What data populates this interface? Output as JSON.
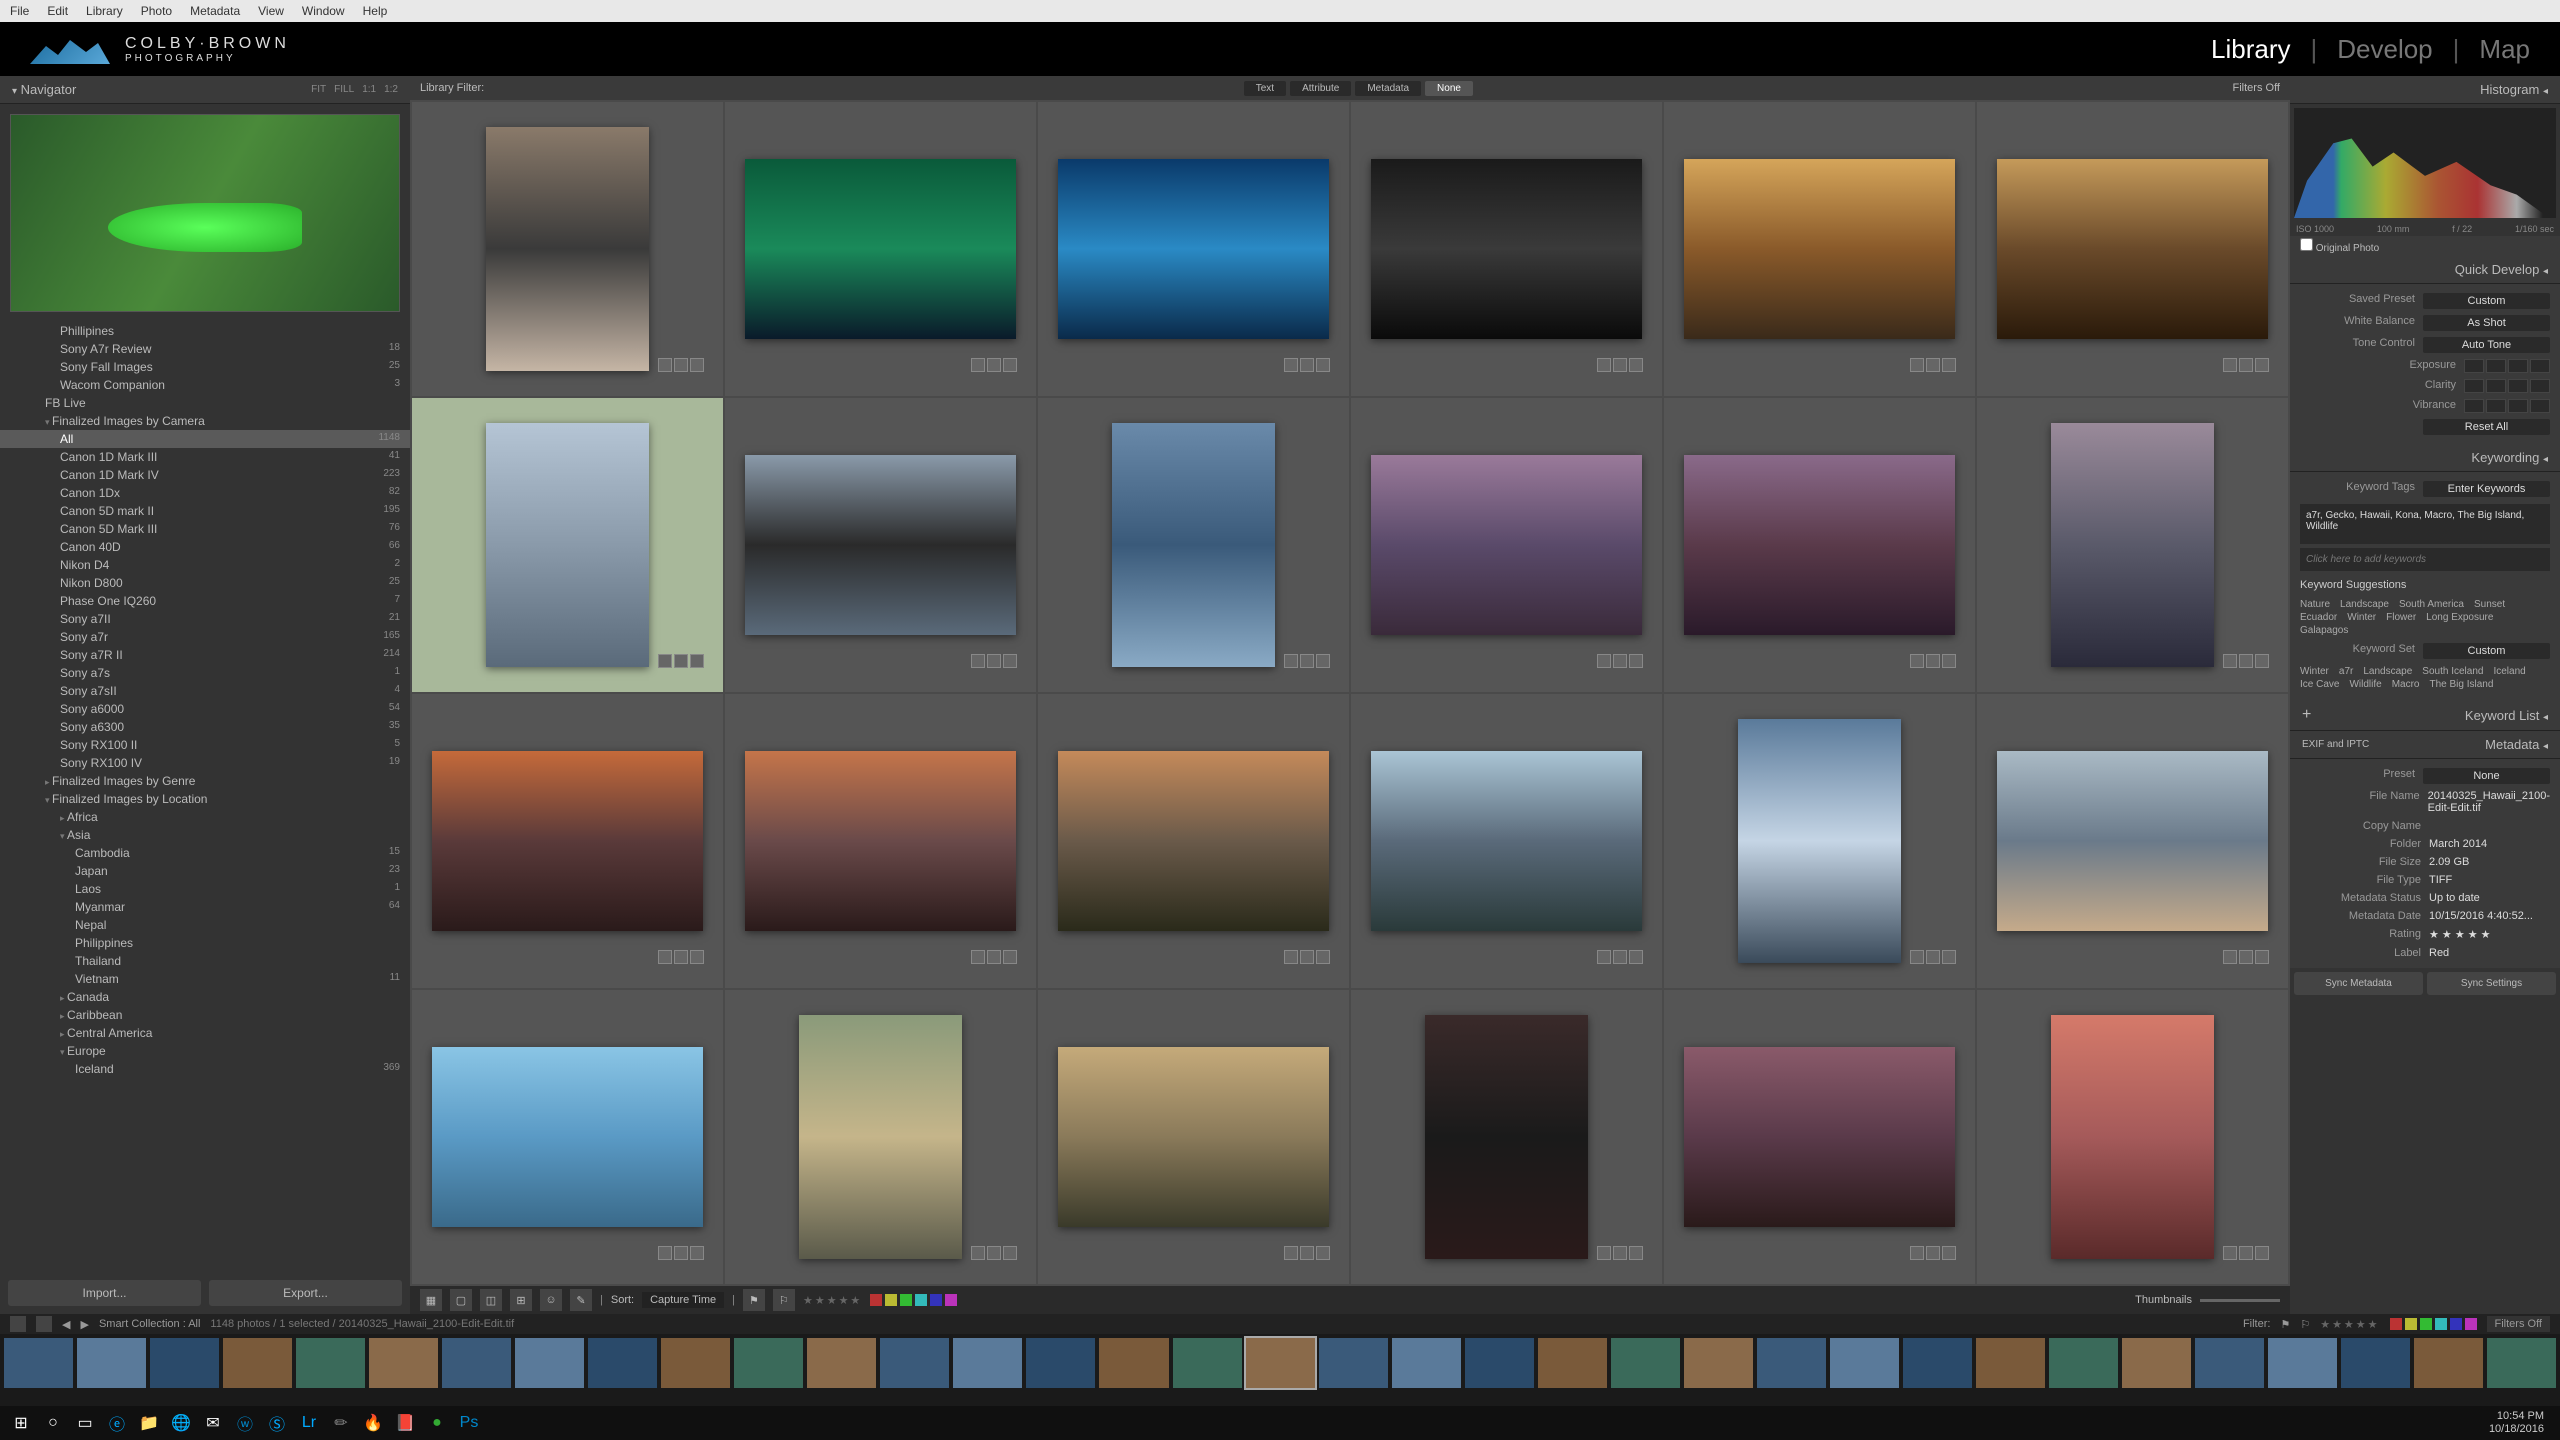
{
  "menu": [
    "File",
    "Edit",
    "Library",
    "Photo",
    "Metadata",
    "View",
    "Window",
    "Help"
  ],
  "logo": {
    "line1": "COLBY·BROWN",
    "line2": "PHOTOGRAPHY"
  },
  "modules": [
    "Library",
    "Develop",
    "Map"
  ],
  "active_module": "Library",
  "navigator": {
    "title": "Navigator",
    "modes": [
      "FIT",
      "FILL",
      "1:1",
      "1:2"
    ]
  },
  "folders": [
    {
      "name": "Phillipines",
      "count": "",
      "indent": 60,
      "cls": "leaf"
    },
    {
      "name": "Sony A7r Review",
      "count": "18",
      "indent": 60,
      "cls": "leaf"
    },
    {
      "name": "Sony Fall Images",
      "count": "25",
      "indent": 60,
      "cls": "leaf"
    },
    {
      "name": "Wacom Companion",
      "count": "3",
      "indent": 60,
      "cls": "leaf"
    },
    {
      "name": "FB Live",
      "count": "",
      "indent": 45,
      "cls": "leaf"
    },
    {
      "name": "Finalized Images by Camera",
      "count": "",
      "indent": 45,
      "cls": "expanded"
    },
    {
      "name": "All",
      "count": "1148",
      "indent": 60,
      "cls": "leaf selected"
    },
    {
      "name": "Canon 1D Mark III",
      "count": "41",
      "indent": 60,
      "cls": "leaf"
    },
    {
      "name": "Canon 1D Mark IV",
      "count": "223",
      "indent": 60,
      "cls": "leaf"
    },
    {
      "name": "Canon 1Dx",
      "count": "82",
      "indent": 60,
      "cls": "leaf"
    },
    {
      "name": "Canon 5D mark II",
      "count": "195",
      "indent": 60,
      "cls": "leaf"
    },
    {
      "name": "Canon 5D Mark III",
      "count": "76",
      "indent": 60,
      "cls": "leaf"
    },
    {
      "name": "Canon 40D",
      "count": "66",
      "indent": 60,
      "cls": "leaf"
    },
    {
      "name": "Nikon D4",
      "count": "2",
      "indent": 60,
      "cls": "leaf"
    },
    {
      "name": "Nikon D800",
      "count": "25",
      "indent": 60,
      "cls": "leaf"
    },
    {
      "name": "Phase One IQ260",
      "count": "7",
      "indent": 60,
      "cls": "leaf"
    },
    {
      "name": "Sony a7II",
      "count": "21",
      "indent": 60,
      "cls": "leaf"
    },
    {
      "name": "Sony a7r",
      "count": "165",
      "indent": 60,
      "cls": "leaf"
    },
    {
      "name": "Sony a7R II",
      "count": "214",
      "indent": 60,
      "cls": "leaf"
    },
    {
      "name": "Sony a7s",
      "count": "1",
      "indent": 60,
      "cls": "leaf"
    },
    {
      "name": "Sony a7sII",
      "count": "4",
      "indent": 60,
      "cls": "leaf"
    },
    {
      "name": "Sony a6000",
      "count": "54",
      "indent": 60,
      "cls": "leaf"
    },
    {
      "name": "Sony a6300",
      "count": "35",
      "indent": 60,
      "cls": "leaf"
    },
    {
      "name": "Sony RX100 II",
      "count": "5",
      "indent": 60,
      "cls": "leaf"
    },
    {
      "name": "Sony RX100 IV",
      "count": "19",
      "indent": 60,
      "cls": "leaf"
    },
    {
      "name": "Finalized Images by Genre",
      "count": "",
      "indent": 45,
      "cls": ""
    },
    {
      "name": "Finalized Images by Location",
      "count": "",
      "indent": 45,
      "cls": "expanded"
    },
    {
      "name": "Africa",
      "count": "",
      "indent": 60,
      "cls": ""
    },
    {
      "name": "Asia",
      "count": "",
      "indent": 60,
      "cls": "expanded"
    },
    {
      "name": "Cambodia",
      "count": "15",
      "indent": 75,
      "cls": "leaf"
    },
    {
      "name": "Japan",
      "count": "23",
      "indent": 75,
      "cls": "leaf"
    },
    {
      "name": "Laos",
      "count": "1",
      "indent": 75,
      "cls": "leaf"
    },
    {
      "name": "Myanmar",
      "count": "64",
      "indent": 75,
      "cls": "leaf"
    },
    {
      "name": "Nepal",
      "count": "",
      "indent": 75,
      "cls": "leaf"
    },
    {
      "name": "Philippines",
      "count": "",
      "indent": 75,
      "cls": "leaf"
    },
    {
      "name": "Thailand",
      "count": "",
      "indent": 75,
      "cls": "leaf"
    },
    {
      "name": "Vietnam",
      "count": "11",
      "indent": 75,
      "cls": "leaf"
    },
    {
      "name": "Canada",
      "count": "",
      "indent": 60,
      "cls": ""
    },
    {
      "name": "Caribbean",
      "count": "",
      "indent": 60,
      "cls": ""
    },
    {
      "name": "Central America",
      "count": "",
      "indent": 60,
      "cls": ""
    },
    {
      "name": "Europe",
      "count": "",
      "indent": 60,
      "cls": "expanded"
    },
    {
      "name": "Iceland",
      "count": "369",
      "indent": 75,
      "cls": "leaf"
    }
  ],
  "import_btn": "Import...",
  "export_btn": "Export...",
  "filter_bar": {
    "label": "Library Filter:",
    "types": [
      "Text",
      "Attribute",
      "Metadata",
      "None"
    ],
    "active": "None",
    "status": "Filters Off"
  },
  "grid": [
    {
      "orient": "portrait",
      "bg": "linear-gradient(#8a7a6a,#3a3a3a,#c5b5a5)",
      "sel": false
    },
    {
      "orient": "landscape",
      "bg": "linear-gradient(#0a5a3a,#1a8a5a,#0a1a2a)",
      "sel": false
    },
    {
      "orient": "landscape",
      "bg": "linear-gradient(#0a3a6a,#2a8ac5,#0a2a4a)",
      "sel": false
    },
    {
      "orient": "landscape",
      "bg": "linear-gradient(#1a1a1a,#3a3a3a,#0a0a0a)",
      "sel": false
    },
    {
      "orient": "landscape",
      "bg": "linear-gradient(#d5a55a,#8a5a2a,#3a2a1a)",
      "sel": false
    },
    {
      "orient": "landscape",
      "bg": "linear-gradient(#c59a5a,#6a4a2a,#2a1a0a)",
      "sel": false
    },
    {
      "orient": "portrait",
      "bg": "linear-gradient(#b5c5d5,#8a9aaa,#5a6a7a)",
      "sel": true
    },
    {
      "orient": "landscape",
      "bg": "linear-gradient(#8a9aaa,#2a2a2a,#5a6a7a)",
      "sel": false
    },
    {
      "orient": "portrait",
      "bg": "linear-gradient(#6a8aaa,#3a5a7a,#8aaac5)",
      "sel": false
    },
    {
      "orient": "landscape",
      "bg": "linear-gradient(#9a7a9a,#5a4a6a,#3a2a3a)",
      "sel": false
    },
    {
      "orient": "landscape",
      "bg": "linear-gradient(#8a6a8a,#5a3a4a,#2a1a2a)",
      "sel": false
    },
    {
      "orient": "portrait",
      "bg": "linear-gradient(#9a8a9a,#5a5a6a,#2a2a3a)",
      "sel": false
    },
    {
      "orient": "landscape",
      "bg": "linear-gradient(#c56a3a,#5a3a3a,#2a1a1a)",
      "sel": false
    },
    {
      "orient": "landscape",
      "bg": "linear-gradient(#c5754a,#6a4a4a,#2a1a1a)",
      "sel": false
    },
    {
      "orient": "landscape",
      "bg": "linear-gradient(#c58a5a,#6a5a4a,#2a2a1a)",
      "sel": false
    },
    {
      "orient": "landscape",
      "bg": "linear-gradient(#aac5d5,#5a6a7a,#2a3a3a)",
      "sel": false
    },
    {
      "orient": "portrait",
      "bg": "linear-gradient(#5a7a9a,#c5d5e5,#3a4a5a)",
      "sel": false
    },
    {
      "orient": "landscape",
      "bg": "linear-gradient(#aabac5,#6a7a8a,#c5aa8a)",
      "sel": false
    },
    {
      "orient": "landscape",
      "bg": "linear-gradient(#8ac5e5,#5a9ac5,#3a6a8a)",
      "sel": false
    },
    {
      "orient": "portrait",
      "bg": "linear-gradient(#8a9a7a,#c5b58a,#5a5a4a)",
      "sel": false
    },
    {
      "orient": "landscape",
      "bg": "linear-gradient(#c5aa7a,#8a7a5a,#3a3a2a)",
      "sel": false
    },
    {
      "orient": "portrait",
      "bg": "linear-gradient(#3a2a2a,#1a1a1a,#2a1a1a)",
      "sel": false
    },
    {
      "orient": "landscape",
      "bg": "linear-gradient(#8a5a6a,#5a3a4a,#2a1a1a)",
      "sel": false
    },
    {
      "orient": "portrait",
      "bg": "linear-gradient(#d57a6a,#a55a5a,#5a2a2a)",
      "sel": false
    }
  ],
  "toolbar": {
    "sort_label": "Sort:",
    "sort_value": "Capture Time",
    "thumbnails": "Thumbnails"
  },
  "color_swatches": [
    "#b33",
    "#bb3",
    "#3b3",
    "#3bb",
    "#33b",
    "#b3b"
  ],
  "histogram": {
    "title": "Histogram",
    "info": [
      "ISO 1000",
      "100 mm",
      "f / 22",
      "1/160 sec"
    ],
    "original": "Original Photo"
  },
  "quick_develop": {
    "title": "Quick Develop",
    "saved_preset": {
      "label": "Saved Preset",
      "value": "Custom"
    },
    "white_balance": {
      "label": "White Balance",
      "value": "As Shot"
    },
    "tone_control": {
      "label": "Tone Control",
      "value": "Auto Tone"
    },
    "exposure": "Exposure",
    "clarity": "Clarity",
    "vibrance": "Vibrance",
    "reset": "Reset All"
  },
  "keywording": {
    "title": "Keywording",
    "tags_label": "Keyword Tags",
    "tags_mode": "Enter Keywords",
    "keywords": "a7r, Gecko, Hawaii, Kona, Macro, The Big Island, Wildlife",
    "placeholder": "Click here to add keywords",
    "suggestions_label": "Keyword Suggestions",
    "suggestions": [
      "Nature",
      "Landscape",
      "South America",
      "Sunset",
      "Ecuador",
      "Winter",
      "Flower",
      "Long Exposure",
      "Galapagos"
    ],
    "set_label": "Keyword Set",
    "set_value": "Custom",
    "set_items": [
      "Winter",
      "a7r",
      "Landscape",
      "South Iceland",
      "Iceland",
      "Ice Cave",
      "Wildlife",
      "Macro",
      "The Big Island"
    ]
  },
  "keyword_list": {
    "title": "Keyword List"
  },
  "metadata": {
    "title": "Metadata",
    "mode": "EXIF and IPTC",
    "preset_label": "Preset",
    "preset_value": "None",
    "fields": [
      {
        "label": "File Name",
        "value": "20140325_Hawaii_2100-Edit-Edit.tif"
      },
      {
        "label": "Copy Name",
        "value": ""
      },
      {
        "label": "Folder",
        "value": "March 2014"
      },
      {
        "label": "File Size",
        "value": "2.09 GB"
      },
      {
        "label": "File Type",
        "value": "TIFF"
      },
      {
        "label": "Metadata Status",
        "value": "Up to date"
      },
      {
        "label": "Metadata Date",
        "value": "10/15/2016 4:40:52..."
      },
      {
        "label": "Rating",
        "value": "★ ★ ★ ★ ★"
      },
      {
        "label": "Label",
        "value": "Red"
      }
    ]
  },
  "sync": {
    "metadata": "Sync Metadata",
    "settings": "Sync Settings"
  },
  "filmstrip": {
    "info": "Smart Collection : All",
    "count": "1148 photos / 1 selected / 20140325_Hawaii_2100-Edit-Edit.tif",
    "filter_label": "Filter:",
    "filters_off": "Filters Off",
    "thumbs": 35
  },
  "taskbar": {
    "icons": [
      "⊞",
      "○",
      "▭",
      "ⓔ",
      "📁",
      "🌐",
      "✉",
      "ⓦ",
      "Ⓢ",
      "Lr",
      "✏",
      "🔥",
      "📕",
      "●",
      "Ps"
    ],
    "time": "10:54 PM",
    "date": "10/18/2016"
  }
}
